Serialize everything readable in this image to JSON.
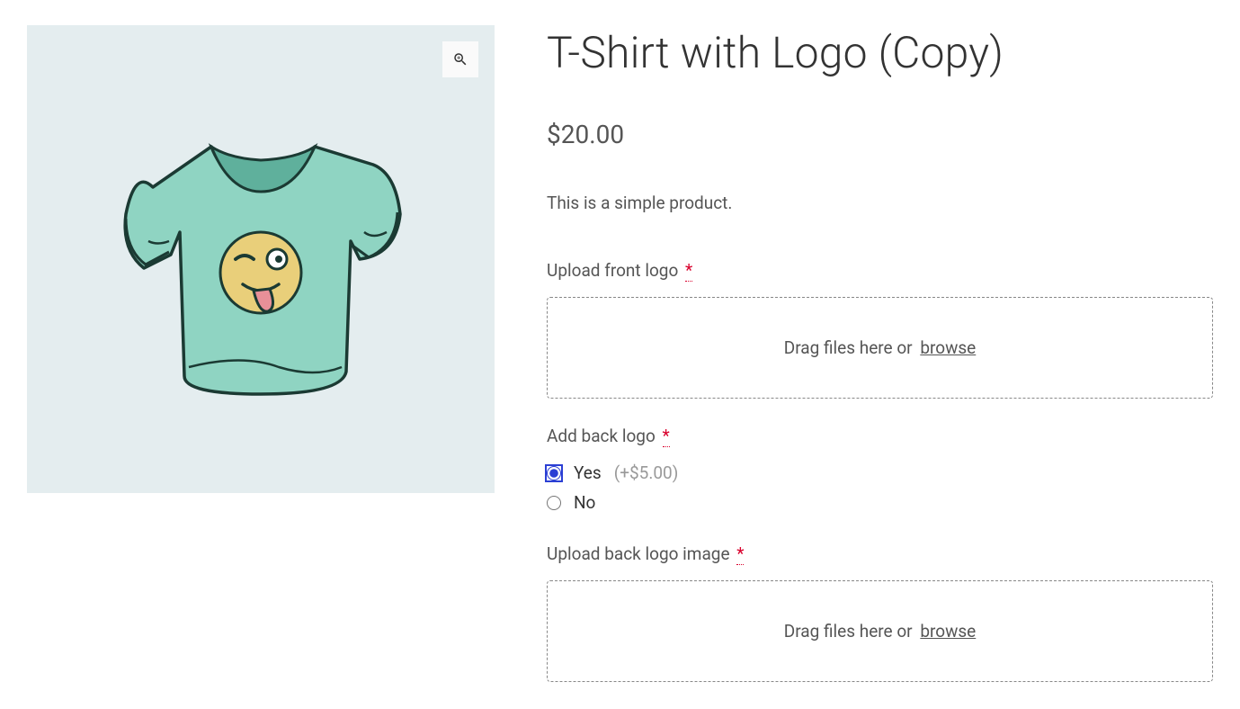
{
  "product": {
    "title": "T-Shirt with Logo (Copy)",
    "price": "$20.00",
    "description": "This is a simple product."
  },
  "fields": {
    "front_logo": {
      "label": "Upload front logo",
      "required_mark": "*"
    },
    "back_logo_choice": {
      "label": "Add back logo",
      "required_mark": "*",
      "options": [
        {
          "label": "Yes",
          "price_modifier": "(+$5.00)",
          "selected": true
        },
        {
          "label": "No",
          "price_modifier": "",
          "selected": false
        }
      ]
    },
    "back_logo_image": {
      "label": "Upload back logo image",
      "required_mark": "*"
    }
  },
  "dropzone": {
    "prefix": "Drag files here or ",
    "browse": "browse"
  }
}
